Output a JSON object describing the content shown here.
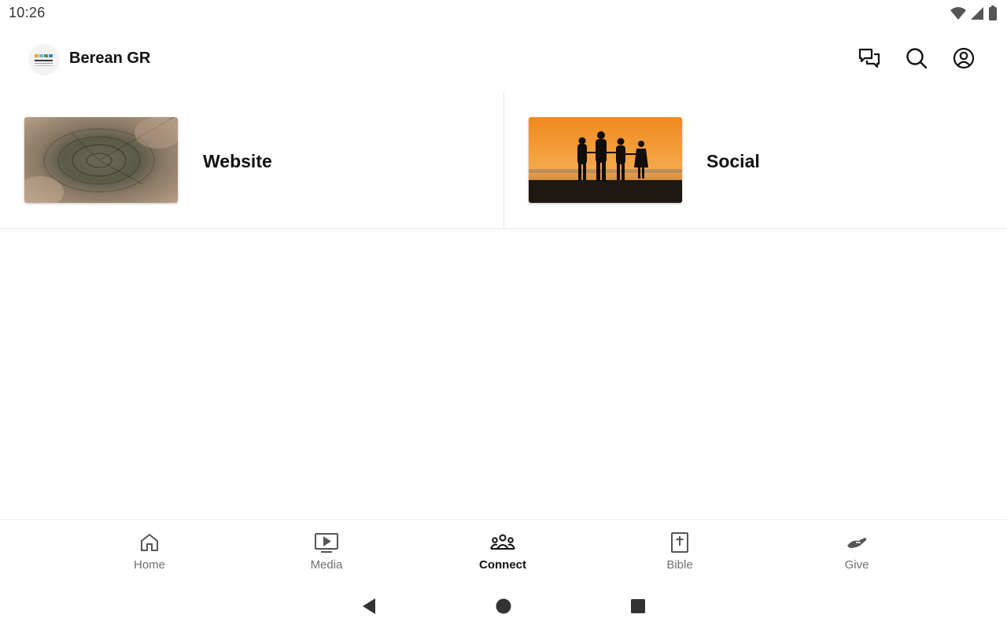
{
  "status_bar": {
    "time": "10:26",
    "icons": [
      "wifi-icon",
      "cellular-signal-icon",
      "battery-icon"
    ]
  },
  "app_bar": {
    "title": "Berean GR",
    "logo_icon": "church-logo",
    "actions": [
      "chat-icon",
      "search-icon",
      "account-icon"
    ]
  },
  "cards": [
    {
      "label": "Website",
      "thumbnail": "tree-rings-wood-image"
    },
    {
      "label": "Social",
      "thumbnail": "sunset-family-silhouette-image"
    }
  ],
  "bottom_nav": {
    "items": [
      {
        "label": "Home",
        "icon": "home-icon",
        "active": false
      },
      {
        "label": "Media",
        "icon": "media-play-icon",
        "active": false
      },
      {
        "label": "Connect",
        "icon": "people-group-icon",
        "active": true
      },
      {
        "label": "Bible",
        "icon": "bible-book-icon",
        "active": false
      },
      {
        "label": "Give",
        "icon": "give-hand-icon",
        "active": false
      }
    ]
  },
  "system_nav": [
    "back-icon",
    "home-circle-icon",
    "recents-square-icon"
  ],
  "colors": {
    "text_primary": "#111111",
    "text_secondary": "#707070",
    "divider": "#e4e4e4",
    "sunset_orange": "#f29a2e"
  }
}
